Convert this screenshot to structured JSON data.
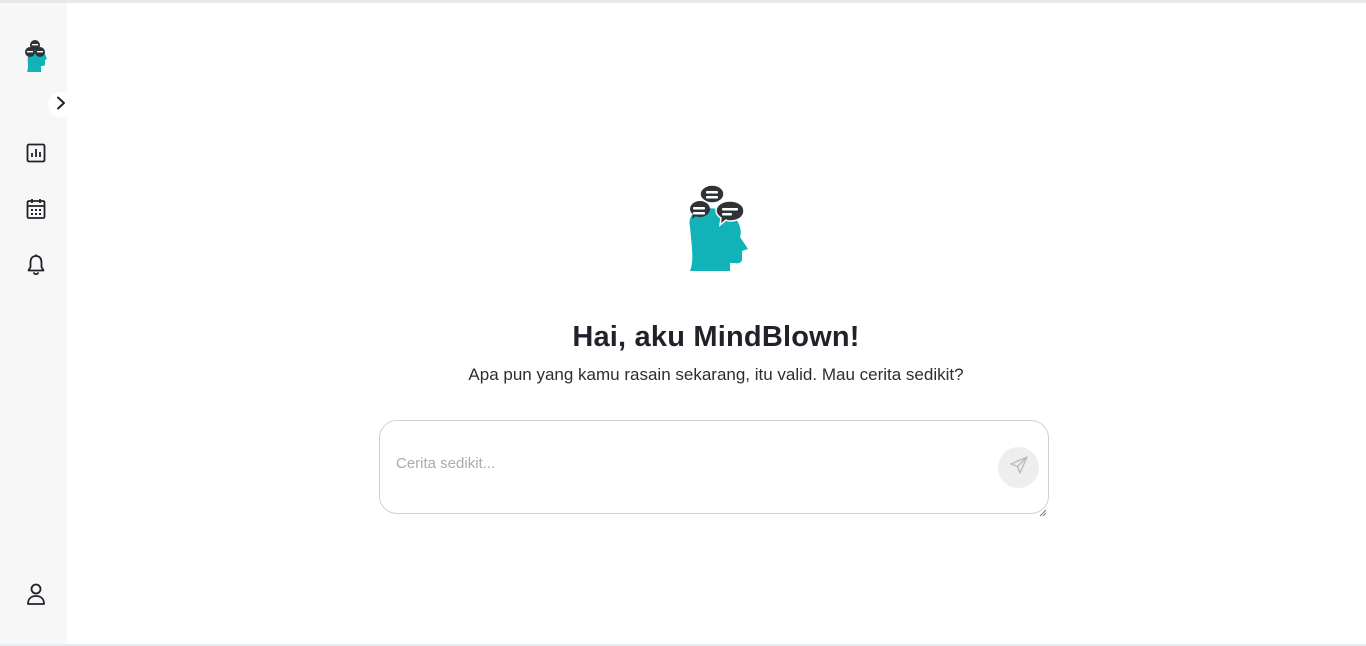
{
  "app": {
    "name": "MindBlown"
  },
  "sidebar": {
    "logo_icon": "mindblown-head-logo-icon",
    "expand_icon": "chevron-right-icon",
    "nav_items": [
      {
        "icon": "bar-chart-icon"
      },
      {
        "icon": "calendar-icon"
      },
      {
        "icon": "bell-icon"
      }
    ],
    "profile_icon": "user-icon"
  },
  "main": {
    "title": "Hai, aku MindBlown!",
    "subtitle": "Apa pun yang kamu rasain sekarang, itu valid. Mau cerita sedikit?",
    "chat_input": {
      "placeholder": "Cerita sedikit...",
      "value": ""
    },
    "send_icon": "send-icon"
  },
  "colors": {
    "brand_teal": "#12b3b8",
    "bubble_dark": "#2f3336",
    "sidebar_bg": "#f7f7f8",
    "text_dark": "#1f2329"
  }
}
